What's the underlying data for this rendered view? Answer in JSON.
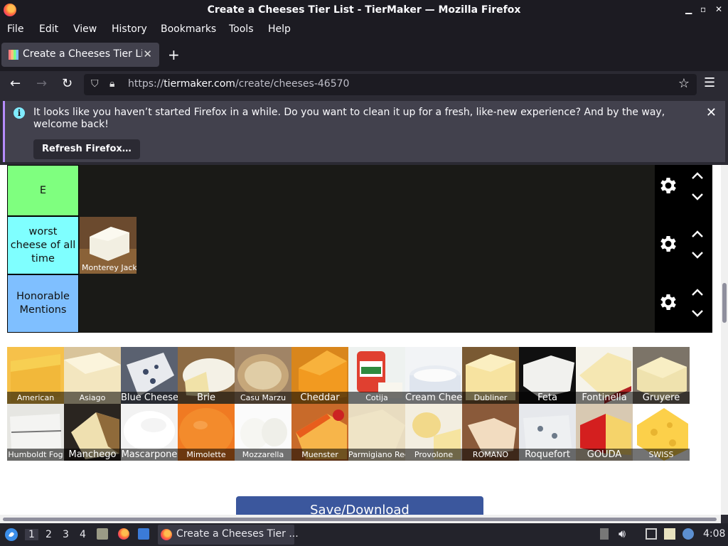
{
  "window": {
    "title": "Create a Cheeses Tier List - TierMaker — Mozilla Firefox"
  },
  "menu": [
    "File",
    "Edit",
    "View",
    "History",
    "Bookmarks",
    "Tools",
    "Help"
  ],
  "tab": {
    "label": "Create a Cheeses Tier List - TierMaker"
  },
  "url": {
    "host": "tiermaker.com",
    "prefix": "https://",
    "path": "/create/cheeses-46570"
  },
  "notification": {
    "message": "It looks like you haven’t started Firefox in a while. Do you want to clean it up for a fresh, like-new experience? And by the way, welcome back!",
    "button": "Refresh Firefox…"
  },
  "tiers": [
    {
      "label": "E",
      "color": "#7fff7f"
    },
    {
      "label": "worst cheese of all time",
      "color": "#7fffff",
      "items": [
        "Monterey Jack"
      ]
    },
    {
      "label": "Honorable Mentions",
      "color": "#7fbfff"
    }
  ],
  "pool_row1": [
    "American",
    "Asiago",
    "Blue Cheese",
    "Brie",
    "Casu Marzu",
    "Cheddar",
    "Cotija",
    "Cream Cheese",
    "Dubliner",
    "Feta",
    "Fontinella",
    "Gruyere"
  ],
  "pool_row2": [
    "Humboldt Fog",
    "Manchego",
    "Mascarpone",
    "Mimolette",
    "Mozzarella",
    "Muenster",
    "Parmigiano Reggiano",
    "Provolone",
    "ROMANO",
    "Roquefort",
    "GOUDA",
    "SWISS"
  ],
  "save_button": "Save/Download",
  "taskbar": {
    "workspaces": [
      "1",
      "2",
      "3",
      "4"
    ],
    "task": "Create a Cheeses Tier ...",
    "clock": "4:08"
  }
}
